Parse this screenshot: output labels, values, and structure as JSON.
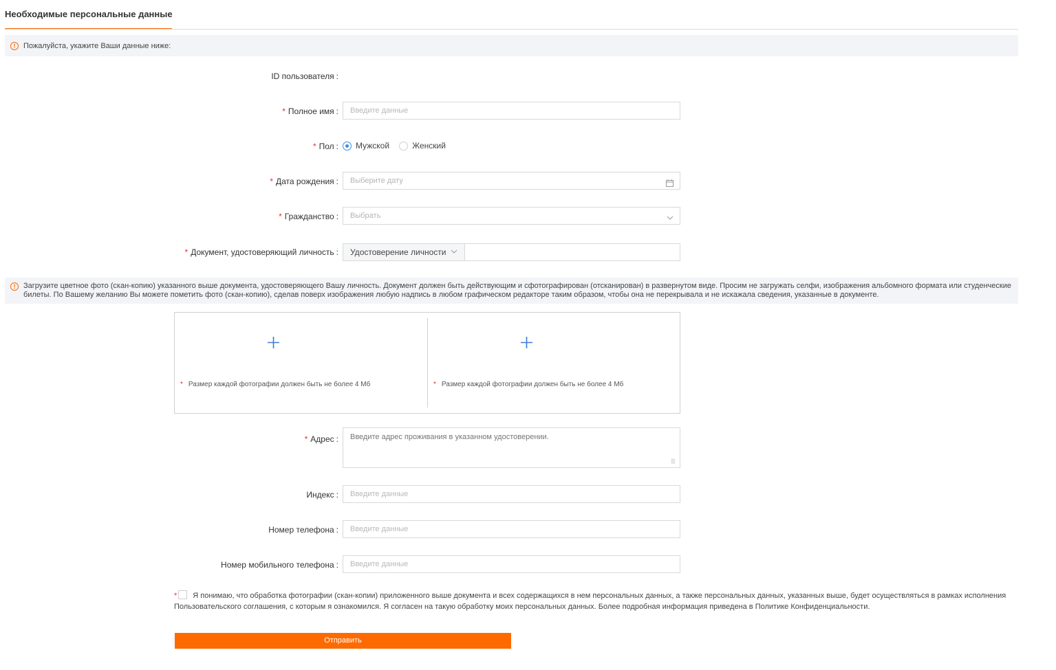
{
  "header": {
    "title": "Необходимые персональные данные"
  },
  "notice_top": {
    "icon": "warning-circle-icon",
    "text": "Пожалуйста, укажите Ваши данные ниже:"
  },
  "form": {
    "colon": ":",
    "user_id": {
      "label": "ID пользователя",
      "value": ""
    },
    "full_name": {
      "label": "Полное имя",
      "placeholder": "Введите данные"
    },
    "gender": {
      "label": "Пол",
      "options": [
        {
          "label": "Мужской",
          "checked": true
        },
        {
          "label": "Женский",
          "checked": false
        }
      ]
    },
    "birth_date": {
      "label": "Дата рождения",
      "placeholder": "Выберите дату",
      "icon": "calendar-icon"
    },
    "citizenship": {
      "label": "Гражданство",
      "placeholder": "Выбрать",
      "icon": "chevron-down-icon"
    },
    "id_document": {
      "label": "Документ, удостоверяющий личность",
      "type_value": "Удостоверение личности",
      "number_value": ""
    },
    "address": {
      "label": "Адрес",
      "placeholder": "Введите адрес проживания в указанном удостоверении."
    },
    "postal_code": {
      "label": "Индекс",
      "placeholder": "Введите данные"
    },
    "phone": {
      "label": "Номер телефона",
      "placeholder": "Введите данные"
    },
    "mobile": {
      "label": "Номер мобильного телефона",
      "placeholder": "Введите данные"
    }
  },
  "notice_upload": {
    "icon": "warning-circle-icon",
    "text": "Загрузите цветное фото (скан-копию) указанного выше документа, удостоверяющего Вашу личность. Документ должен быть действующим и сфотографирован (отсканирован) в развернутом виде. Просим не загружать селфи, изображения альбомного формата или студенческие билеты. По Вашему желанию Вы можете пометить фото (скан-копию), сделав поверх изображения любую надпись в любом графическом редакторе таким образом, чтобы она не перекрывала и не искажала сведения, указанные в документе."
  },
  "upload": {
    "slots": [
      {
        "icon": "plus-icon",
        "note": "Размер каждой фотографии должен быть не более 4 Мб"
      },
      {
        "icon": "plus-icon",
        "note": "Размер каждой фотографии должен быть не более 4 Мб"
      }
    ]
  },
  "consent": {
    "checked": false,
    "text": "Я понимаю, что обработка фотографии (скан-копии) приложенного выше документа и всех содержащихся в нем персональных данных, а также персональных данных, указанных выше, будет осуществляться в рамках исполнения Пользовательского соглашения, с которым я ознакомился. Я согласен на такую обработку моих персональных данных. Более подробная информация приведена в Политике Конфиденциальности."
  },
  "submit": {
    "label": "Отправить"
  },
  "colors": {
    "accent": "#ff6a00",
    "required": "#e62e2e",
    "radio_selected": "#3a8ee6",
    "plus_icon": "#3a7bd5",
    "notice_bg": "#f3f4f7"
  }
}
